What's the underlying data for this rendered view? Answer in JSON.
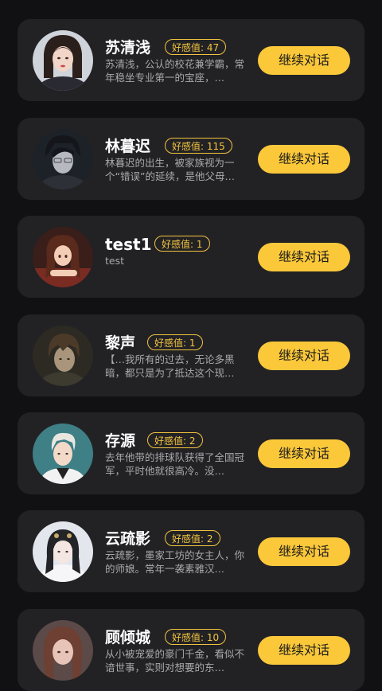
{
  "characters": [
    {
      "name": "苏清浅",
      "affinity": "好感值: 47",
      "desc": "苏清浅，公认的校花兼学霸，常年稳坐专业第一的宝座，…",
      "action": "继续对话"
    },
    {
      "name": "林暮迟",
      "affinity": "好感值: 115",
      "desc": "林暮迟的出生，被家族视为一个“错误”的延续，是他父母…",
      "action": "继续对话"
    },
    {
      "name": "test1",
      "affinity": "好感值: 1",
      "desc": "test",
      "action": "继续对话"
    },
    {
      "name": "黎声",
      "affinity": "好感值: 1",
      "desc": "【…我所有的过去，无论多黑暗，都只是为了抵达这个现…",
      "action": "继续对话"
    },
    {
      "name": "存源",
      "affinity": "好感值: 2",
      "desc": "去年他带的排球队获得了全国冠军，平时他就很高冷。没…",
      "action": "继续对话"
    },
    {
      "name": "云疏影",
      "affinity": "好感值: 2",
      "desc": "云疏影，墨家工坊的女主人，你的师娘。常年一袭素雅汉…",
      "action": "继续对话"
    },
    {
      "name": "顾倾城",
      "affinity": "好感值: 10",
      "desc": "从小被宠爱的豪门千金，看似不谙世事，实则对想要的东…",
      "action": "继续对话"
    }
  ]
}
